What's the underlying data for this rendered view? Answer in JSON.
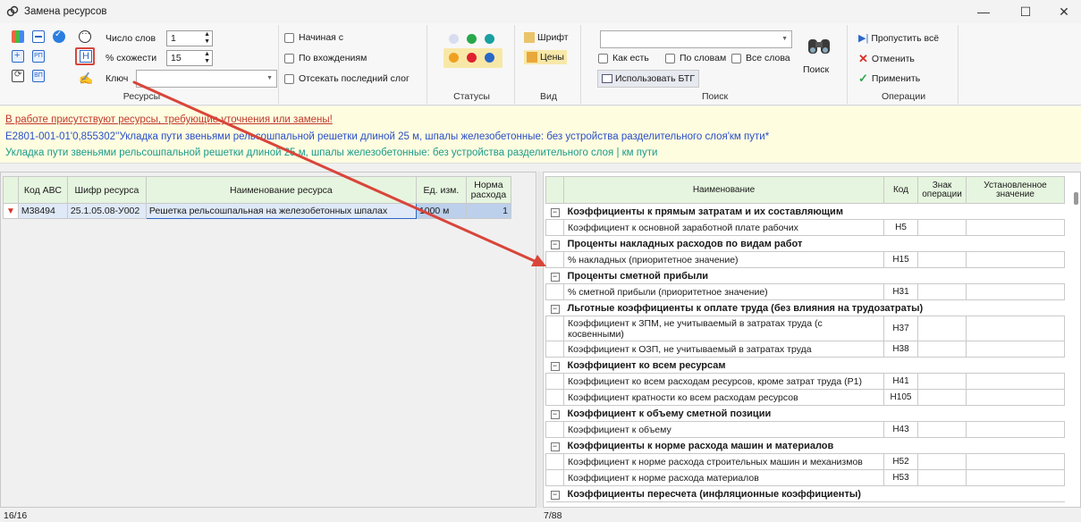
{
  "window": {
    "title": "Замена ресурсов"
  },
  "ribbon": {
    "resources": {
      "label": "Ресурсы",
      "word_count_label": "Число слов",
      "word_count_value": "1",
      "similarity_label": "% схожести",
      "similarity_value": "15",
      "key_label": "Ключ",
      "key_value": "",
      "icons": {
        "rp": "РП",
        "vp": "ВП",
        "n": "Н"
      }
    },
    "options": {
      "starts_with": "Начиная с",
      "by_occurrences": "По вхождениям",
      "cut_last_syllable": "Отсекать последний слог"
    },
    "statuses": {
      "label": "Статусы"
    },
    "view": {
      "label": "Вид",
      "font": "Шрифт",
      "prices": "Цены"
    },
    "search": {
      "label": "Поиск",
      "combo_value": "",
      "as_is": "Как есть",
      "by_words": "По словам",
      "all_words": "Все слова",
      "use_btg": "Использовать БТГ",
      "search_button": "Поиск"
    },
    "operations": {
      "label": "Операции",
      "skip_all": "Пропустить всё",
      "cancel": "Отменить",
      "apply": "Применить"
    }
  },
  "message": {
    "warning": "В работе присутствуют ресурсы, требующие уточнения или замены!",
    "code_line": "Е2801-001-01'0,855302''Укладка пути звеньями рельсошпальной решетки длиной 25 м, шпалы железобетонные: без устройства разделительного слоя'км пути*",
    "description_line": "Укладка пути звеньями рельсошпальной решетки длиной 25 м, шпалы железобетонные: без устройства разделительного слоя   |   км пути"
  },
  "resources_table": {
    "headers": [
      "Код АВС",
      "Шифр ресурса",
      "Наименование ресурса",
      "Ед. изм.",
      "Норма расхода"
    ],
    "rows": [
      {
        "abc": "М38494",
        "code": "25.1.05.08-У002",
        "name": "Решетка рельсошпальная на железобетонных шпалах",
        "unit": "1000 м",
        "norm": "1"
      }
    ]
  },
  "coef_table": {
    "headers": [
      "Наименование",
      "Код",
      "Знак операции",
      "Установленное значение"
    ],
    "groups": [
      {
        "title": "Коэффициенты к прямым затратам и их составляющим",
        "items": [
          {
            "name": "Коэффициент к основной заработной плате рабочих",
            "code": "Н5"
          }
        ]
      },
      {
        "title": "Проценты накладных расходов по видам работ",
        "items": [
          {
            "name": "% накладных (приоритетное значение)",
            "code": "Н15"
          }
        ]
      },
      {
        "title": "Проценты сметной прибыли",
        "items": [
          {
            "name": "% сметной прибыли (приоритетное значение)",
            "code": "Н31"
          }
        ]
      },
      {
        "title": "Льготные коэффициенты к оплате труда (без влияния на трудозатраты)",
        "items": [
          {
            "name": "Коэффициент к ЗПМ, не учитываемый в затратах труда (с косвенными)",
            "code": "Н37"
          },
          {
            "name": "Коэффициент к ОЗП, не учитываемый в затратах труда",
            "code": "Н38"
          }
        ]
      },
      {
        "title": "Коэффициент ко всем ресурсам",
        "items": [
          {
            "name": "Коэффициент ко всем расходам ресурсов, кроме затрат труда (Р1)",
            "code": "Н41"
          },
          {
            "name": "Коэффициент кратности ко всем расходам ресурсов",
            "code": "Н105"
          }
        ]
      },
      {
        "title": "Коэффициент к объему сметной позиции",
        "items": [
          {
            "name": "Коэффициент к объему",
            "code": "Н43"
          }
        ]
      },
      {
        "title": "Коэффициенты к норме расхода машин и материалов",
        "items": [
          {
            "name": "Коэффициент к норме расхода строительных машин и механизмов",
            "code": "Н52"
          },
          {
            "name": "Коэффициент к норме расхода материалов",
            "code": "Н53"
          }
        ]
      },
      {
        "title": "Коэффициенты пересчета (инфляционные коэффициенты)",
        "items": []
      }
    ]
  },
  "status": {
    "left": "16/16",
    "right": "7/88"
  },
  "colors": {
    "arrow": "#d9453a",
    "highlight": "#d9453a",
    "header_bg": "#e6f5df",
    "message_bg": "#fffde0"
  }
}
